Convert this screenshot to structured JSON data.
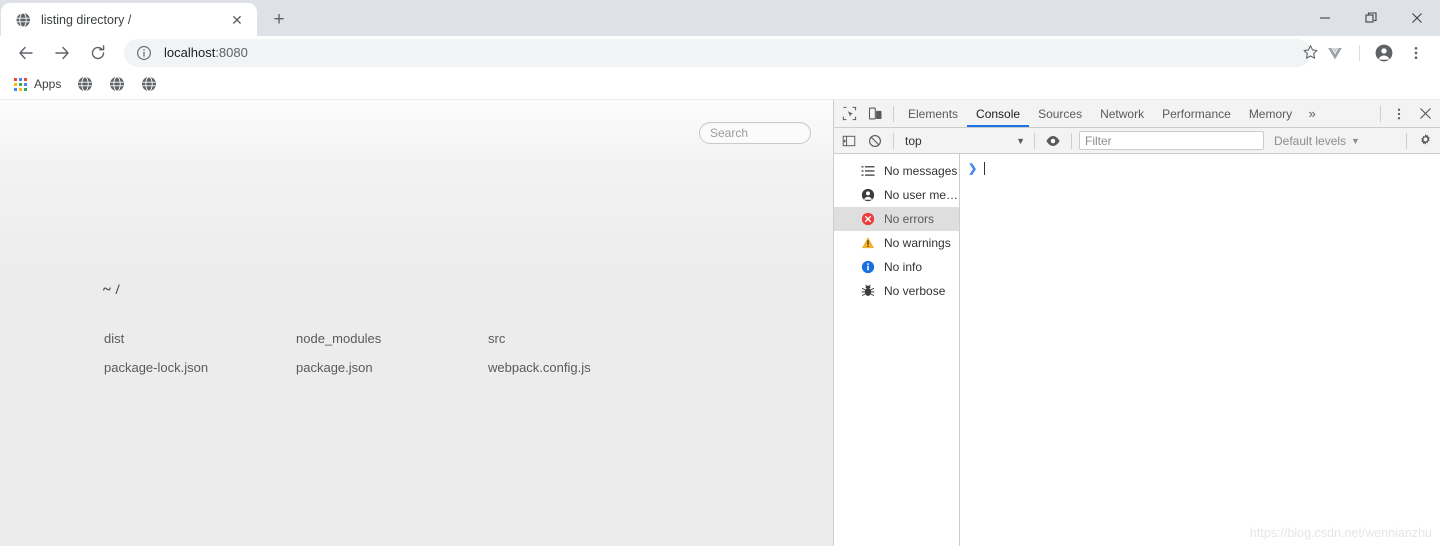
{
  "browser": {
    "tab": {
      "title": "listing directory /",
      "favicon": "globe-icon",
      "close_label": "✕"
    },
    "new_tab_label": "+",
    "window_controls": {
      "minimize": "minimize-icon",
      "maximize": "restore-icon",
      "close": "close-icon"
    },
    "toolbar": {
      "back": "back-arrow-icon",
      "forward": "forward-arrow-icon",
      "reload": "reload-icon",
      "site_info": "info-circle-icon",
      "url_host": "localhost",
      "url_port": ":8080",
      "url_full": "localhost:8080",
      "bookmark": "star-icon",
      "extension": "vue-devtools-icon",
      "profile": "profile-avatar-icon",
      "menu": "kebab-menu-icon"
    },
    "bookmarks": {
      "apps_label": "Apps",
      "apps_icon": "apps-grid-icon",
      "items": [
        {
          "icon": "globe-icon"
        },
        {
          "icon": "globe-icon"
        },
        {
          "icon": "globe-icon"
        }
      ]
    }
  },
  "page": {
    "search": {
      "placeholder": "Search",
      "value": ""
    },
    "directory_title": "~ /",
    "entries": [
      [
        "dist",
        "node_modules",
        "src"
      ],
      [
        "package-lock.json",
        "package.json",
        "webpack.config.js"
      ]
    ]
  },
  "devtools": {
    "left_icons": [
      {
        "name": "inspect-element-icon"
      },
      {
        "name": "device-toolbar-icon"
      }
    ],
    "tabs": [
      {
        "label": "Elements",
        "active": false
      },
      {
        "label": "Console",
        "active": true
      },
      {
        "label": "Sources",
        "active": false
      },
      {
        "label": "Network",
        "active": false
      },
      {
        "label": "Performance",
        "active": false
      },
      {
        "label": "Memory",
        "active": false
      }
    ],
    "overflow_label": "»",
    "more_menu": "kebab-menu-icon",
    "close": "close-icon",
    "filterbar": {
      "sidebar_toggle": "console-sidebar-toggle-icon",
      "clear_console": "clear-console-icon",
      "context": "top",
      "context_caret": "▼",
      "live_expression": "eye-icon",
      "filter_placeholder": "Filter",
      "filter_value": "",
      "levels_label": "Default levels",
      "levels_caret": "▼",
      "settings": "gear-icon"
    },
    "sidebar": [
      {
        "label": "No messages",
        "icon": "list-icon",
        "selected": false
      },
      {
        "label": "No user me…",
        "icon": "user-icon",
        "selected": false
      },
      {
        "label": "No errors",
        "icon": "error-icon",
        "selected": true
      },
      {
        "label": "No warnings",
        "icon": "warning-icon",
        "selected": false
      },
      {
        "label": "No info",
        "icon": "info-icon",
        "selected": false
      },
      {
        "label": "No verbose",
        "icon": "bug-icon",
        "selected": false
      }
    ],
    "prompt": {
      "arrow": "❯",
      "value": ""
    }
  },
  "watermark": "https://blog.csdn.net/wennianzhu",
  "colors": {
    "titlebar": "#dee1e6",
    "accent": "#1a73e8",
    "error": "#ee3b3b",
    "warning": "#f2b230",
    "info": "#1a73e8",
    "prompt": "#4285f4",
    "sidebar_selected": "#dedede"
  }
}
